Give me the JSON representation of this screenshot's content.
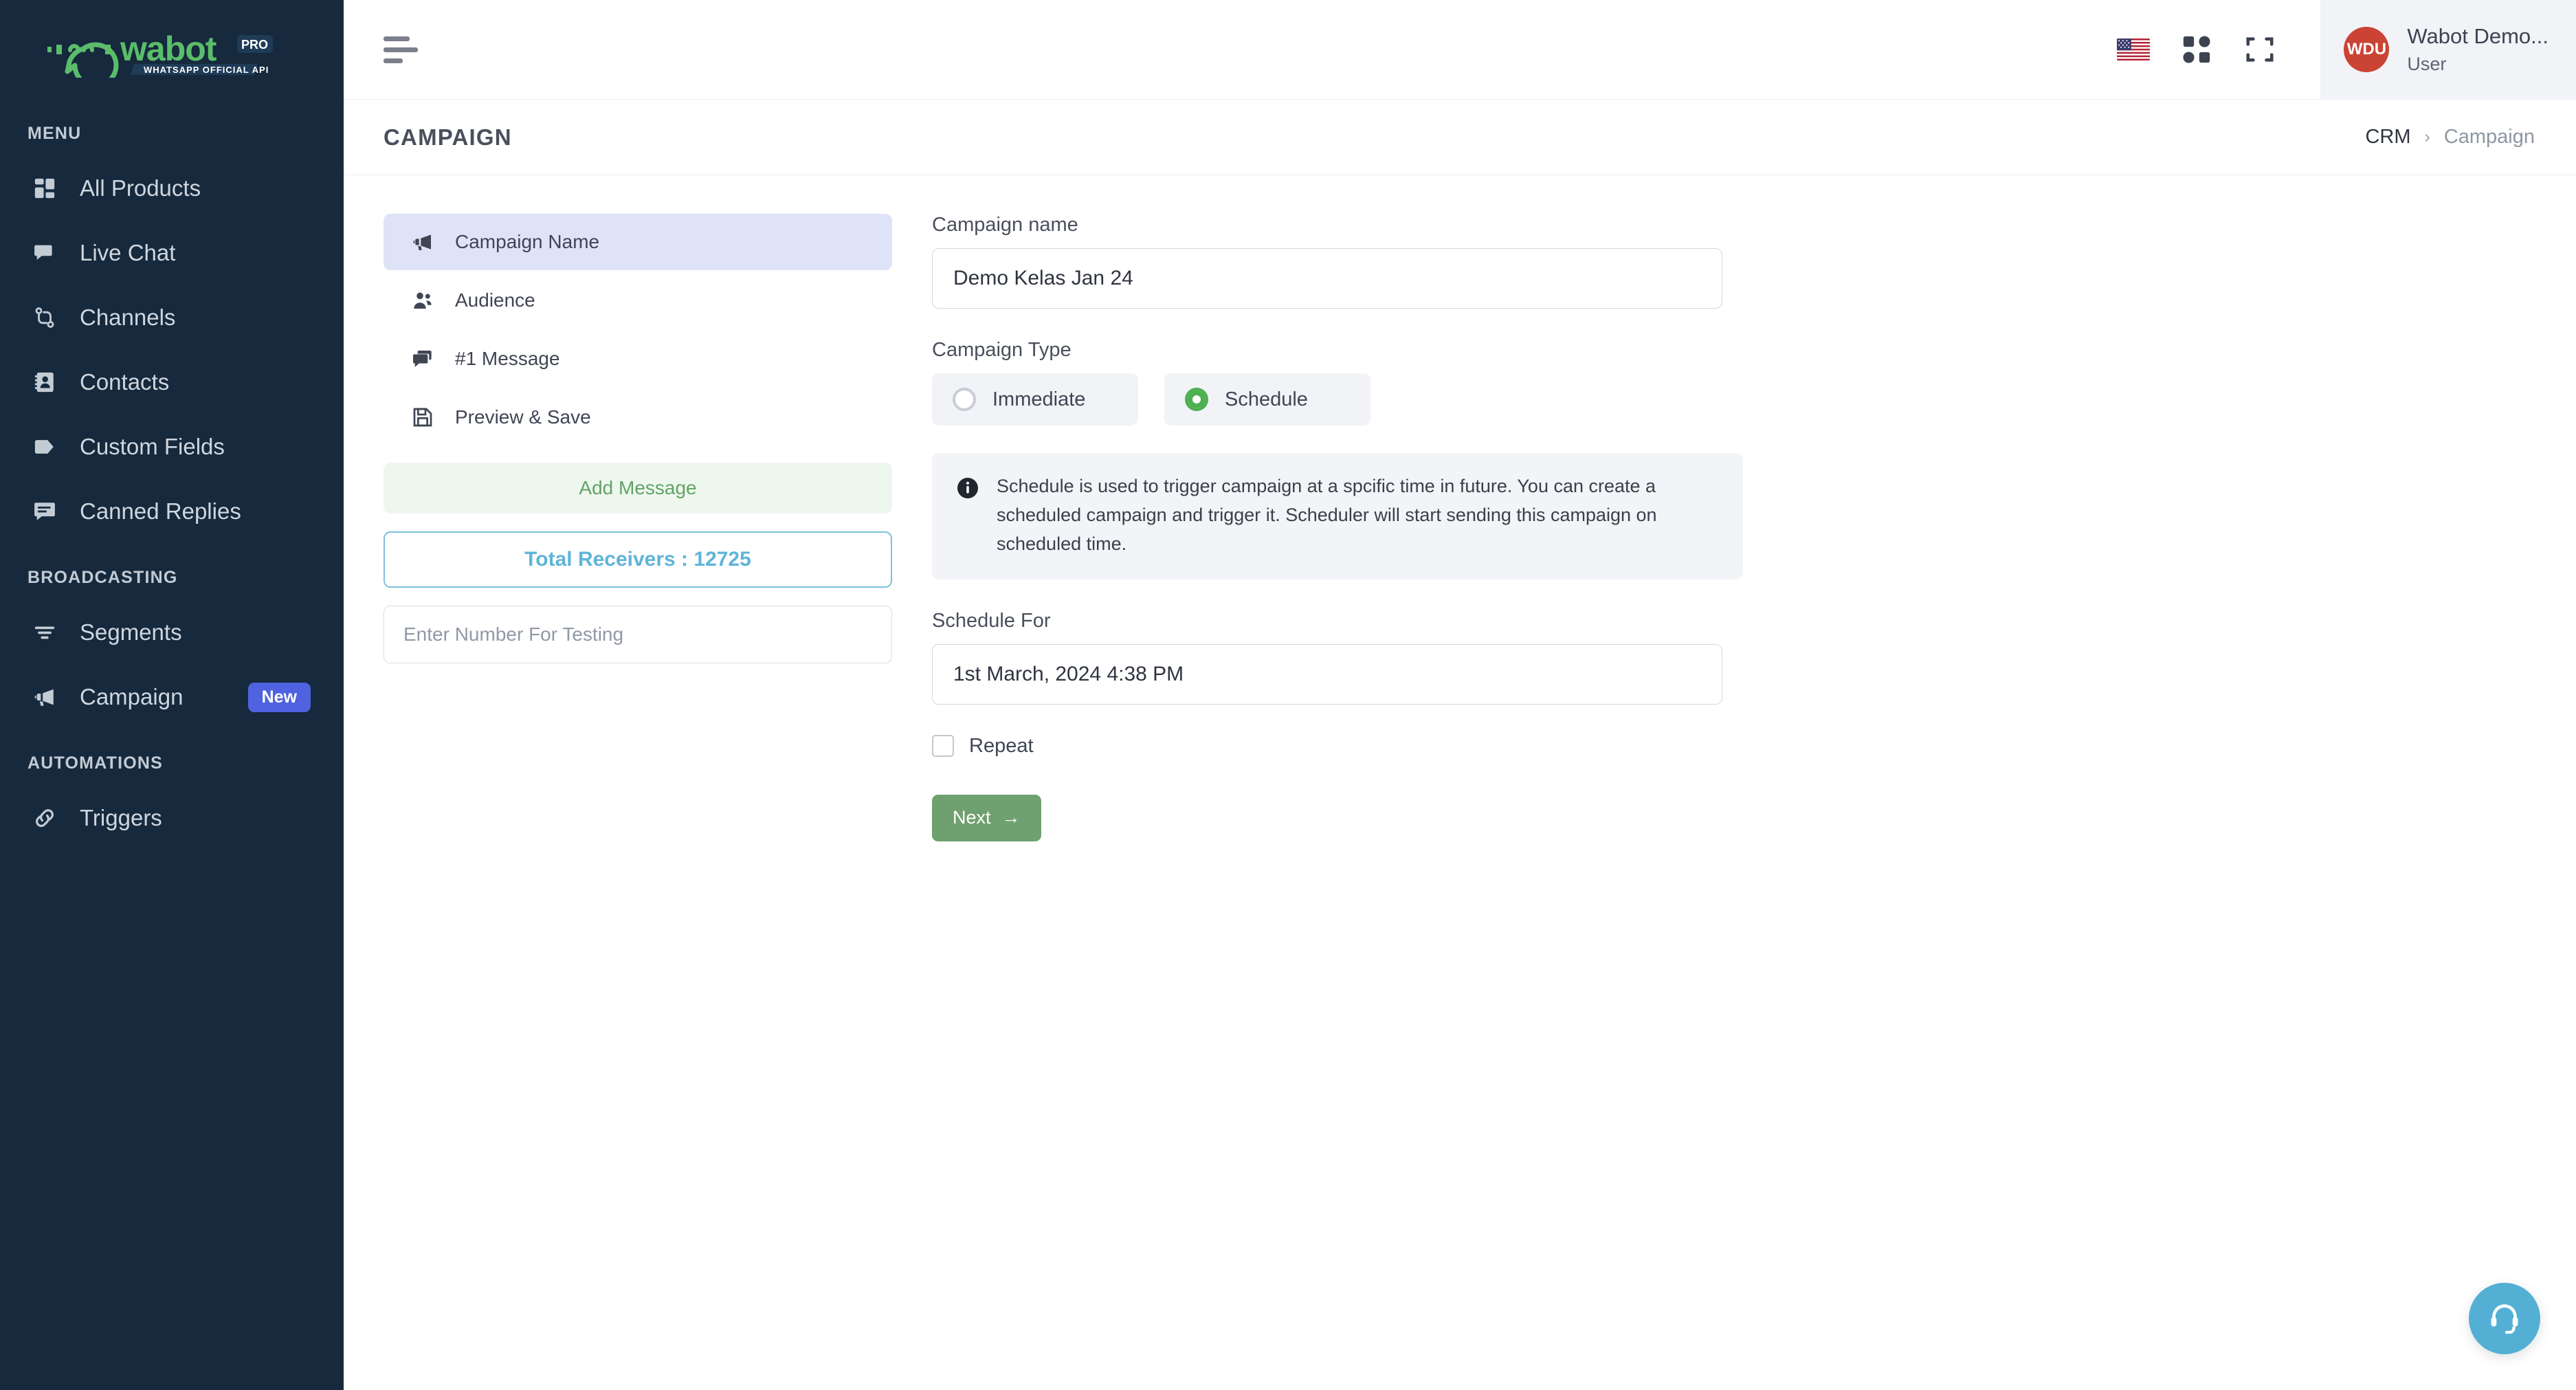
{
  "brand": {
    "logo_text": "wabot",
    "logo_badge": "PRO",
    "logo_tagline": "WHATSAPP OFFICIAL API",
    "green": "#5bbd6a",
    "sidebar_bg": "#16293d"
  },
  "sidebar": {
    "sections": [
      {
        "title": "MENU",
        "items": [
          {
            "label": "All Products",
            "icon": "grid-icon",
            "badge": null
          },
          {
            "label": "Live Chat",
            "icon": "chat-icon",
            "badge": null
          },
          {
            "label": "Channels",
            "icon": "channels-icon",
            "badge": null
          },
          {
            "label": "Contacts",
            "icon": "contacts-icon",
            "badge": null
          },
          {
            "label": "Custom Fields",
            "icon": "tag-icon",
            "badge": null
          },
          {
            "label": "Canned Replies",
            "icon": "canned-reply-icon",
            "badge": null
          }
        ]
      },
      {
        "title": "BROADCASTING",
        "items": [
          {
            "label": "Segments",
            "icon": "filter-icon",
            "badge": null
          },
          {
            "label": "Campaign",
            "icon": "megaphone-icon",
            "badge": "New"
          }
        ]
      },
      {
        "title": "AUTOMATIONS",
        "items": [
          {
            "label": "Triggers",
            "icon": "link-icon",
            "badge": null
          }
        ]
      }
    ]
  },
  "topbar": {
    "menu_toggle": "hamburger-icon",
    "language_flag": "us-flag-icon",
    "apps_icon": "apps-grid-icon",
    "fullscreen_icon": "fullscreen-icon",
    "user": {
      "initials": "WDU",
      "name": "Wabot Demo...",
      "role": "User"
    }
  },
  "page": {
    "title": "CAMPAIGN",
    "breadcrumb": {
      "root": "CRM",
      "separator": "›",
      "current": "Campaign"
    }
  },
  "steps": {
    "items": [
      {
        "label": "Campaign Name",
        "icon": "megaphone-icon",
        "active": true
      },
      {
        "label": "Audience",
        "icon": "audience-icon",
        "active": false
      },
      {
        "label": "#1 Message",
        "icon": "message-icon",
        "active": false
      },
      {
        "label": "Preview & Save",
        "icon": "save-icon",
        "active": false
      }
    ],
    "add_message_label": "Add Message",
    "total_receivers_label": "Total Receivers : 12725",
    "total_receivers_count": 12725,
    "test_number_placeholder": "Enter Number For Testing",
    "test_number_value": ""
  },
  "form": {
    "campaign_name_label": "Campaign name",
    "campaign_name_value": "Demo Kelas Jan 24",
    "campaign_type_label": "Campaign Type",
    "campaign_type_options": [
      {
        "label": "Immediate",
        "selected": false
      },
      {
        "label": "Schedule",
        "selected": true
      }
    ],
    "info_icon": "info-icon",
    "info_text": "Schedule is used to trigger campaign at a spcific time in future. You can create a scheduled campaign and trigger it. Scheduler will start sending this campaign on scheduled time.",
    "schedule_for_label": "Schedule For",
    "schedule_for_value": "1st March, 2024 4:38 PM",
    "repeat_label": "Repeat",
    "repeat_checked": false,
    "next_label": "Next",
    "next_arrow": "→"
  },
  "support": {
    "icon": "headset-icon",
    "color": "#53b0d4"
  }
}
